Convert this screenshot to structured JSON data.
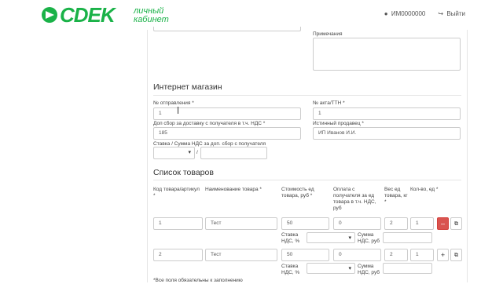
{
  "header": {
    "brand": "CDEK",
    "brand_sub_line1": "личный",
    "brand_sub_line2": "кабинет",
    "user_label": "ИМ0000000",
    "logout_label": "Выйти",
    "brand_color": "#1ab248"
  },
  "remarks": {
    "label": "Примечания",
    "value": ""
  },
  "shop": {
    "title": "Интернет магазин",
    "shipment_no_label": "№ отправления *",
    "shipment_no_value": "1",
    "act_label": "№ акта/ТТН *",
    "act_value": "1",
    "fee_label": "Доп сбор за доставку с получателя в т.ч. НДС *",
    "fee_value": "185",
    "seller_label": "Истинный продавец *",
    "seller_value": "ИП Иванов И.И.",
    "vat_label": "Ставка / Сумма НДС за доп. сбор с получателя",
    "vat_rate_value": "",
    "vat_sum_value": "",
    "slash": "/"
  },
  "goods": {
    "title": "Список товаров",
    "columns": {
      "code": "Код товара/артикул *",
      "name": "Наименование товара *",
      "cost": "Стоимость ед товара, руб *",
      "payment": "Оплата с получателя за ед товара в т.ч. НДС, руб",
      "weight": "Вес ед товара, кг *",
      "qty": "Кол-во, ед *"
    },
    "vat_rate_label": "Ставка НДС, %",
    "vat_sum_label": "Сумма НДС, руб",
    "rows": [
      {
        "code": "1",
        "name": "Тест",
        "cost": "50",
        "payment": "0",
        "weight": "2",
        "qty": "1",
        "action": "–"
      },
      {
        "code": "2",
        "name": "Тест",
        "cost": "50",
        "payment": "0",
        "weight": "2",
        "qty": "1",
        "action": "+"
      }
    ],
    "footnote": "*Все поля обязательны к заполнению"
  },
  "icons": {
    "user": "user-icon",
    "logout": "logout-icon",
    "copy": "copy-icon",
    "caret": "caret-down-icon"
  }
}
